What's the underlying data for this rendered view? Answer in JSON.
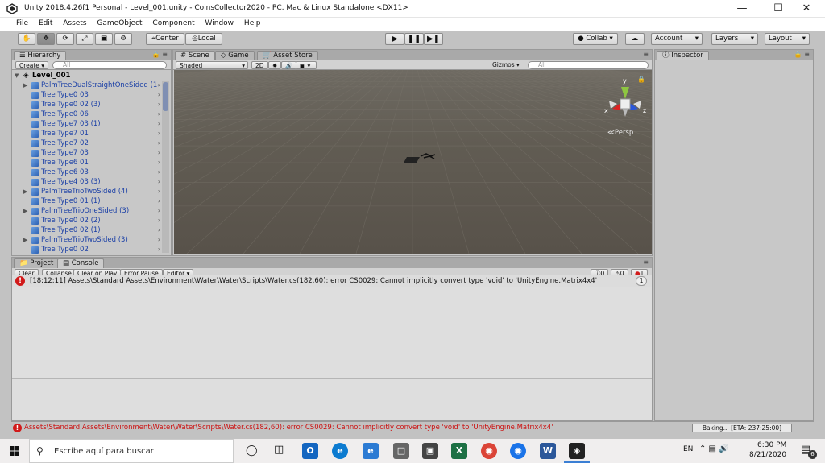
{
  "window": {
    "title": "Unity 2018.4.26f1 Personal - Level_001.unity - CoinsCollector2020 - PC, Mac & Linux Standalone <DX11>"
  },
  "menu": [
    "File",
    "Edit",
    "Assets",
    "GameObject",
    "Component",
    "Window",
    "Help"
  ],
  "toolbar": {
    "pivot_label": "Center",
    "space_label": "Local",
    "collab_label": "Collab",
    "account_label": "Account",
    "layers_label": "Layers",
    "layout_label": "Layout"
  },
  "hierarchy": {
    "tab": "Hierarchy",
    "create_label": "Create",
    "search_placeholder": "All",
    "scene_name": "Level_001",
    "items": [
      {
        "label": "PalmTreeDualStraightOneSided (1-",
        "expandable": true
      },
      {
        "label": "Tree Type0 03",
        "expandable": false
      },
      {
        "label": "Tree Type0 02 (3)",
        "expandable": false
      },
      {
        "label": "Tree Type0 06",
        "expandable": false
      },
      {
        "label": "Tree Type7 03 (1)",
        "expandable": false
      },
      {
        "label": "Tree Type7 01",
        "expandable": false
      },
      {
        "label": "Tree Type7 02",
        "expandable": false
      },
      {
        "label": "Tree Type7 03",
        "expandable": false
      },
      {
        "label": "Tree Type6 01",
        "expandable": false
      },
      {
        "label": "Tree Type6 03",
        "expandable": false
      },
      {
        "label": "Tree Type4 03 (3)",
        "expandable": false
      },
      {
        "label": "PalmTreeTrioTwoSided (4)",
        "expandable": true
      },
      {
        "label": "Tree Type0 01 (1)",
        "expandable": false
      },
      {
        "label": "PalmTreeTrioOneSided (3)",
        "expandable": true
      },
      {
        "label": "Tree Type0 02 (2)",
        "expandable": false
      },
      {
        "label": "Tree Type0 02 (1)",
        "expandable": false
      },
      {
        "label": "PalmTreeTrioTwoSided (3)",
        "expandable": true
      },
      {
        "label": "Tree Type0 02",
        "expandable": false
      }
    ]
  },
  "scene": {
    "tabs": [
      "Scene",
      "Game",
      "Asset Store"
    ],
    "shading": "Shaded",
    "mode_2d": "2D",
    "gizmos_label": "Gizmos",
    "search_placeholder": "All",
    "persp_label": "Persp",
    "axis_x": "x",
    "axis_y": "y",
    "axis_z": "z"
  },
  "inspector": {
    "tab": "Inspector"
  },
  "console": {
    "tabs": [
      "Project",
      "Console"
    ],
    "buttons": [
      "Clear",
      "Collapse",
      "Clear on Play",
      "Error Pause",
      "Editor"
    ],
    "count_info": "0",
    "count_warn": "0",
    "count_error": "1",
    "entry": "[18:12:11] Assets\\Standard Assets\\Environment\\Water\\Water\\Scripts\\Water.cs(182,60): error CS0029: Cannot implicitly convert type 'void' to 'UnityEngine.Matrix4x4'",
    "entry_count": "1"
  },
  "status": {
    "message": "Assets\\Standard Assets\\Environment\\Water\\Water\\Scripts\\Water.cs(182,60): error CS0029: Cannot implicitly convert type 'void' to 'UnityEngine.Matrix4x4'",
    "baking": "Baking... [ETA: 237:25:00]"
  },
  "taskbar": {
    "search_placeholder": "Escribe aquí para buscar",
    "language": "EN",
    "time": "6:30 PM",
    "date": "8/21/2020",
    "notif_count": "6"
  },
  "colors": {
    "error_red": "#d11a1a",
    "hier_blue": "#1a3fa6",
    "unity_gray": "#c2c2c2"
  }
}
